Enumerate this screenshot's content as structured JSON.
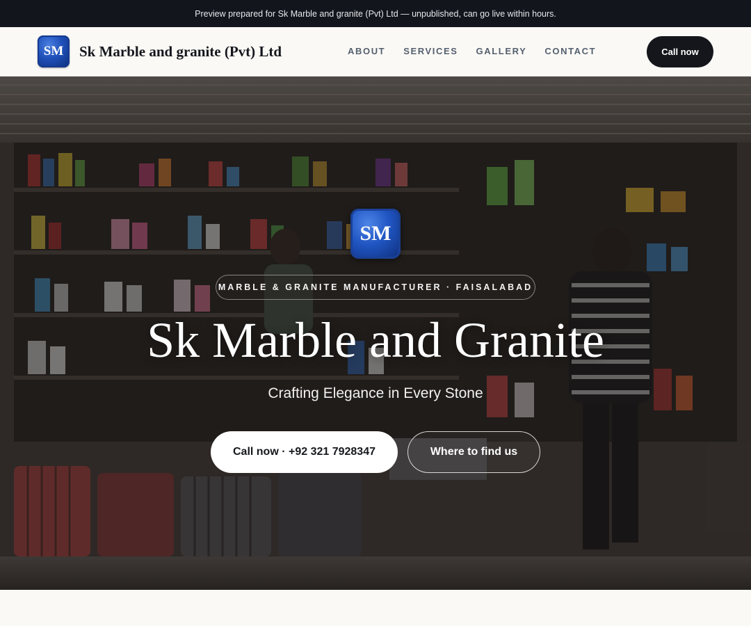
{
  "topbar": {
    "notice": "Preview prepared for Sk Marble and granite (Pvt) Ltd — unpublished, can go live within hours."
  },
  "header": {
    "logo_text": "SM",
    "brand_name": "Sk Marble and granite (Pvt) Ltd",
    "nav": [
      {
        "label": "ABOUT"
      },
      {
        "label": "SERVICES"
      },
      {
        "label": "GALLERY"
      },
      {
        "label": "CONTACT"
      }
    ],
    "cta_label": "Call now"
  },
  "hero": {
    "logo_text": "SM",
    "kicker": "MARBLE & GRANITE MANUFACTURER · FAISALABAD",
    "title": "Sk Marble and Granite",
    "subtitle": "Crafting Elegance in Every Stone",
    "primary_button": "Call now · +92 321 7928347",
    "secondary_button": "Where to find us"
  },
  "colors": {
    "topbar_bg": "#12151c",
    "dark_button": "#14161b",
    "logo_blue": "#1e4fb8",
    "page_bg": "#faf9f6"
  }
}
